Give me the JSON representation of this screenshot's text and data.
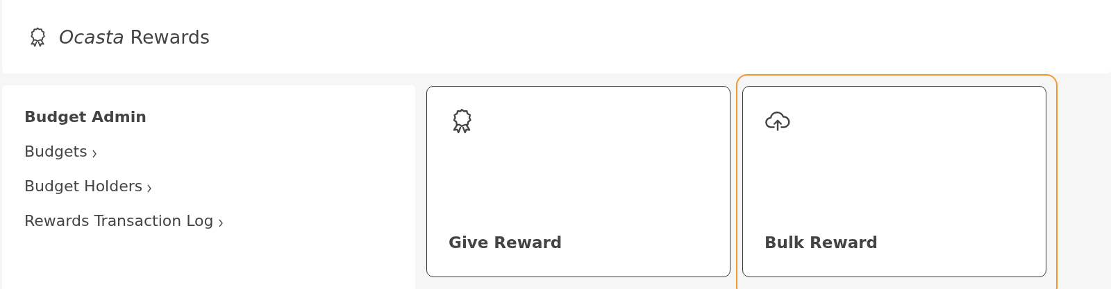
{
  "header": {
    "title": "*Ocasta* Rewards"
  },
  "sidebar": {
    "heading": "Budget Admin",
    "items": [
      {
        "label": "Budgets"
      },
      {
        "label": "Budget Holders"
      },
      {
        "label": "Rewards Transaction Log"
      }
    ]
  },
  "cards": [
    {
      "kind": "award",
      "label": "Give Reward",
      "selected": false
    },
    {
      "kind": "upload",
      "label": "Bulk Reward",
      "selected": true
    }
  ]
}
